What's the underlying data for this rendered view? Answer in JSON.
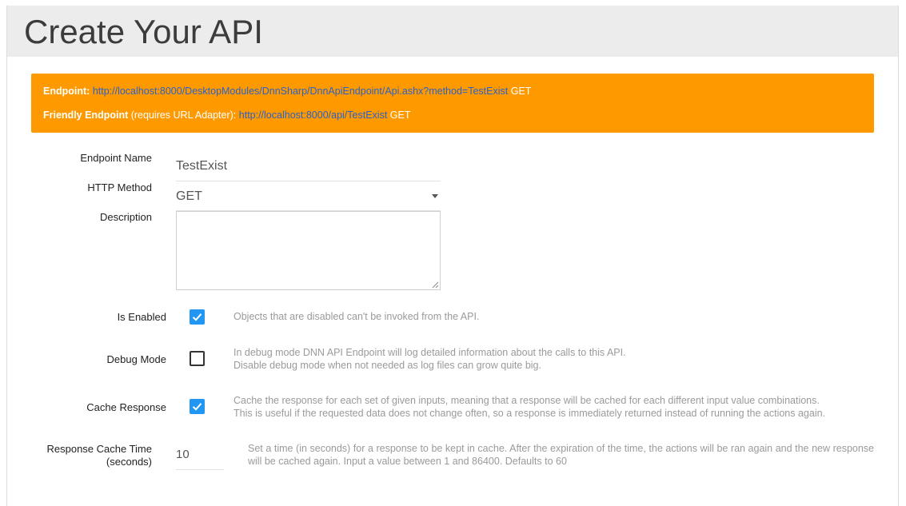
{
  "header": {
    "title": "Create Your API"
  },
  "banner": {
    "endpoint_label": "Endpoint:",
    "endpoint_url": "http://localhost:8000/DesktopModules/DnnSharp/DnnApiEndpoint/Api.ashx?method=TestExist",
    "endpoint_method": "GET",
    "friendly_label": "Friendly Endpoint",
    "friendly_note": "(requires URL Adapter):",
    "friendly_url": "http://localhost:8000/api/TestExist",
    "friendly_method": "GET",
    "color": "#ff9900"
  },
  "form": {
    "endpoint_name": {
      "label": "Endpoint Name",
      "value": "TestExist"
    },
    "http_method": {
      "label": "HTTP Method",
      "value": "GET"
    },
    "description": {
      "label": "Description",
      "value": ""
    },
    "is_enabled": {
      "label": "Is Enabled",
      "checked": true,
      "help": "Objects that are disabled can't be invoked from the API."
    },
    "debug_mode": {
      "label": "Debug Mode",
      "checked": false,
      "help_line1": "In debug mode DNN API Endpoint will log detailed information about the calls to this API.",
      "help_line2": "Disable debug mode when not needed as log files can grow quite big."
    },
    "cache_response": {
      "label": "Cache Response",
      "checked": true,
      "help_line1": "Cache the response for each set of given inputs, meaning that a response will be cached for each different input value combinations.",
      "help_line2": "This is useful if the requested data does not change often, so a response is immediately returned instead of running the actions again."
    },
    "cache_time": {
      "label_line1": "Response Cache Time",
      "label_line2": "(seconds)",
      "value": "10",
      "help": "Set a time (in seconds) for a response to be kept in cache. After the expiration of the time, the actions will be ran again and the new response will be cached again. Input a value between 1 and 86400. Defaults to 60"
    }
  },
  "colors": {
    "accent": "#2196f3",
    "link": "#2a62c9"
  }
}
